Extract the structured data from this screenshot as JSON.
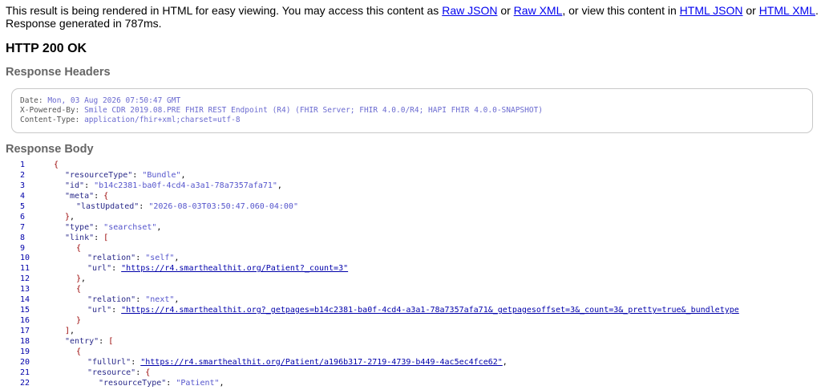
{
  "intro": {
    "prefix": "This result is being rendered in HTML for easy viewing. You may access this content as ",
    "raw_json": "Raw JSON",
    "or1": " or ",
    "raw_xml": "Raw XML",
    "middle": ", or view this content in ",
    "html_json": "HTML JSON",
    "or2": " or ",
    "html_xml": "HTML XML",
    "suffix": ".",
    "response_time": "Response generated in 787ms."
  },
  "status": "HTTP 200 OK",
  "response_headers": {
    "title": "Response Headers",
    "items": [
      {
        "name": "Date: ",
        "value": "Mon, 03 Aug 2026 07:50:47 GMT"
      },
      {
        "name": "X-Powered-By: ",
        "value": "Smile CDR 2019.08.PRE FHIR REST Endpoint (R4) (FHIR Server; FHIR 4.0.0/R4; HAPI FHIR 4.0.0-SNAPSHOT)"
      },
      {
        "name": "Content-Type: ",
        "value": "application/fhir+xml;charset=utf-8"
      }
    ]
  },
  "response_body": {
    "title": "Response Body",
    "lines": [
      {
        "n": "1",
        "indent": 0,
        "parts": [
          {
            "t": "{",
            "c": "brace"
          }
        ]
      },
      {
        "n": "2",
        "indent": 1,
        "parts": [
          {
            "t": "\"resourceType\"",
            "c": "key"
          },
          {
            "t": ": ",
            "c": "punc"
          },
          {
            "t": "\"Bundle\"",
            "c": "str"
          },
          {
            "t": ",",
            "c": "punc"
          }
        ]
      },
      {
        "n": "3",
        "indent": 1,
        "parts": [
          {
            "t": "\"id\"",
            "c": "key"
          },
          {
            "t": ": ",
            "c": "punc"
          },
          {
            "t": "\"b14c2381-ba0f-4cd4-a3a1-78a7357afa71\"",
            "c": "str"
          },
          {
            "t": ",",
            "c": "punc"
          }
        ]
      },
      {
        "n": "4",
        "indent": 1,
        "parts": [
          {
            "t": "\"meta\"",
            "c": "key"
          },
          {
            "t": ": ",
            "c": "punc"
          },
          {
            "t": "{",
            "c": "brace"
          }
        ]
      },
      {
        "n": "5",
        "indent": 2,
        "parts": [
          {
            "t": "\"lastUpdated\"",
            "c": "key"
          },
          {
            "t": ": ",
            "c": "punc"
          },
          {
            "t": "\"2026-08-03T03:50:47.060-04:00\"",
            "c": "str"
          }
        ]
      },
      {
        "n": "6",
        "indent": 1,
        "parts": [
          {
            "t": "}",
            "c": "brace"
          },
          {
            "t": ",",
            "c": "punc"
          }
        ]
      },
      {
        "n": "7",
        "indent": 1,
        "parts": [
          {
            "t": "\"type\"",
            "c": "key"
          },
          {
            "t": ": ",
            "c": "punc"
          },
          {
            "t": "\"searchset\"",
            "c": "str"
          },
          {
            "t": ",",
            "c": "punc"
          }
        ]
      },
      {
        "n": "8",
        "indent": 1,
        "parts": [
          {
            "t": "\"link\"",
            "c": "key"
          },
          {
            "t": ": ",
            "c": "punc"
          },
          {
            "t": "[",
            "c": "brace"
          }
        ]
      },
      {
        "n": "9",
        "indent": 2,
        "parts": [
          {
            "t": "{",
            "c": "brace"
          }
        ]
      },
      {
        "n": "10",
        "indent": 3,
        "parts": [
          {
            "t": "\"relation\"",
            "c": "key"
          },
          {
            "t": ": ",
            "c": "punc"
          },
          {
            "t": "\"self\"",
            "c": "str"
          },
          {
            "t": ",",
            "c": "punc"
          }
        ]
      },
      {
        "n": "11",
        "indent": 3,
        "parts": [
          {
            "t": "\"url\"",
            "c": "key"
          },
          {
            "t": ": ",
            "c": "punc"
          },
          {
            "t": "\"https://r4.smarthealthit.org/Patient?_count=3\"",
            "c": "url"
          }
        ]
      },
      {
        "n": "12",
        "indent": 2,
        "parts": [
          {
            "t": "}",
            "c": "brace"
          },
          {
            "t": ",",
            "c": "punc"
          }
        ]
      },
      {
        "n": "13",
        "indent": 2,
        "parts": [
          {
            "t": "{",
            "c": "brace"
          }
        ]
      },
      {
        "n": "14",
        "indent": 3,
        "parts": [
          {
            "t": "\"relation\"",
            "c": "key"
          },
          {
            "t": ": ",
            "c": "punc"
          },
          {
            "t": "\"next\"",
            "c": "str"
          },
          {
            "t": ",",
            "c": "punc"
          }
        ]
      },
      {
        "n": "15",
        "indent": 3,
        "parts": [
          {
            "t": "\"url\"",
            "c": "key"
          },
          {
            "t": ": ",
            "c": "punc"
          },
          {
            "t": "\"https://r4.smarthealthit.org?_getpages=b14c2381-ba0f-4cd4-a3a1-78a7357afa71&_getpagesoffset=3&_count=3&_pretty=true&_bundletype",
            "c": "url"
          }
        ]
      },
      {
        "n": "16",
        "indent": 2,
        "parts": [
          {
            "t": "}",
            "c": "brace"
          }
        ]
      },
      {
        "n": "17",
        "indent": 1,
        "parts": [
          {
            "t": "]",
            "c": "brace"
          },
          {
            "t": ",",
            "c": "punc"
          }
        ]
      },
      {
        "n": "18",
        "indent": 1,
        "parts": [
          {
            "t": "\"entry\"",
            "c": "key"
          },
          {
            "t": ": ",
            "c": "punc"
          },
          {
            "t": "[",
            "c": "brace"
          }
        ]
      },
      {
        "n": "19",
        "indent": 2,
        "parts": [
          {
            "t": "{",
            "c": "brace"
          }
        ]
      },
      {
        "n": "20",
        "indent": 3,
        "parts": [
          {
            "t": "\"fullUrl\"",
            "c": "key"
          },
          {
            "t": ": ",
            "c": "punc"
          },
          {
            "t": "\"https://r4.smarthealthit.org/Patient/a196b317-2719-4739-b449-4ac5ec4fce62\"",
            "c": "url"
          },
          {
            "t": ",",
            "c": "punc"
          }
        ]
      },
      {
        "n": "21",
        "indent": 3,
        "parts": [
          {
            "t": "\"resource\"",
            "c": "key"
          },
          {
            "t": ": ",
            "c": "punc"
          },
          {
            "t": "{",
            "c": "brace"
          }
        ]
      },
      {
        "n": "22",
        "indent": 4,
        "parts": [
          {
            "t": "\"resourceType\"",
            "c": "key"
          },
          {
            "t": ": ",
            "c": "punc"
          },
          {
            "t": "\"Patient\"",
            "c": "str"
          },
          {
            "t": ",",
            "c": "punc"
          }
        ]
      }
    ]
  },
  "colors": {
    "link": "#0000ee",
    "section_heading": "#666666",
    "line_number": "#0000aa",
    "json_key": "#2a2a8a",
    "json_string": "#5555cc",
    "json_brace": "#990000"
  }
}
